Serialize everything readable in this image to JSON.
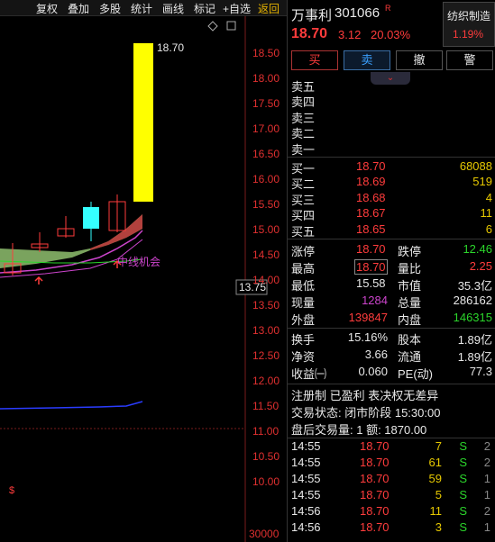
{
  "toolbar": {
    "items": [
      "复权",
      "叠加",
      "多股",
      "统计",
      "画线",
      "标记",
      "+自选",
      "返回"
    ]
  },
  "chart": {
    "y_ticks": [
      "18.50",
      "18.00",
      "17.50",
      "17.00",
      "16.50",
      "16.00",
      "15.50",
      "15.00",
      "14.50",
      "14.00",
      "13.50",
      "13.00",
      "12.50",
      "12.00",
      "11.50",
      "11.00",
      "10.50",
      "10.00"
    ],
    "current_price_tag": "13.75",
    "high_label": "18.70",
    "annotation": "中线机会",
    "s_marker": "$",
    "volume_tick": "30000",
    "colors": {
      "up": "#ff3c3c",
      "down": "#35ffff",
      "limit_bar": "#ffff00",
      "ma": "#cc44cc",
      "fill_green": "#8fbf6f"
    }
  },
  "stock": {
    "name": "万事利",
    "code": "301066",
    "badge": "R",
    "sector": "纺织制造",
    "sector_change": "1.19%",
    "price": "18.70",
    "change": "3.12",
    "change_pct": "20.03%"
  },
  "actions": {
    "buy": "买",
    "sell": "卖",
    "cancel": "撤",
    "alert": "警"
  },
  "sell_levels": [
    {
      "label": "卖五",
      "price": "",
      "vol": ""
    },
    {
      "label": "卖四",
      "price": "",
      "vol": ""
    },
    {
      "label": "卖三",
      "price": "",
      "vol": ""
    },
    {
      "label": "卖二",
      "price": "",
      "vol": ""
    },
    {
      "label": "卖一",
      "price": "",
      "vol": ""
    }
  ],
  "buy_levels": [
    {
      "label": "买一",
      "price": "18.70",
      "vol": "68088"
    },
    {
      "label": "买二",
      "price": "18.69",
      "vol": "519"
    },
    {
      "label": "买三",
      "price": "18.68",
      "vol": "4"
    },
    {
      "label": "买四",
      "price": "18.67",
      "vol": "11"
    },
    {
      "label": "买五",
      "price": "18.65",
      "vol": "6"
    }
  ],
  "stats1": [
    {
      "l": "涨停",
      "v": "18.70",
      "r": "跌停",
      "rv": "12.46"
    },
    {
      "l": "最高",
      "v": "18.70",
      "r": "量比",
      "rv": "2.25"
    },
    {
      "l": "最低",
      "v": "15.58",
      "r": "市值",
      "rv": "35.3亿"
    },
    {
      "l": "现量",
      "v": "1284",
      "r": "总量",
      "rv": "286162"
    },
    {
      "l": "外盘",
      "v": "139847",
      "r": "内盘",
      "rv": "146315"
    }
  ],
  "stats2": [
    {
      "l": "换手",
      "v": "15.16%",
      "r": "股本",
      "rv": "1.89亿"
    },
    {
      "l": "净资",
      "v": "3.66",
      "r": "流通",
      "rv": "1.89亿"
    },
    {
      "l": "收益㈠",
      "v": "0.060",
      "r": "PE(动)",
      "rv": "77.3"
    }
  ],
  "info": {
    "tags": "注册制 已盈利 表决权无差异",
    "status": "交易状态: 闭市阶段 15:30:00",
    "after_hours": "盘后交易量: 1  额: 1870.00"
  },
  "ticks": [
    {
      "t": "14:55",
      "p": "18.70",
      "v": "7",
      "s": "S",
      "n": "2"
    },
    {
      "t": "14:55",
      "p": "18.70",
      "v": "61",
      "s": "S",
      "n": "2"
    },
    {
      "t": "14:55",
      "p": "18.70",
      "v": "59",
      "s": "S",
      "n": "1"
    },
    {
      "t": "14:55",
      "p": "18.70",
      "v": "5",
      "s": "S",
      "n": "1"
    },
    {
      "t": "14:56",
      "p": "18.70",
      "v": "11",
      "s": "S",
      "n": "2"
    },
    {
      "t": "14:56",
      "p": "18.70",
      "v": "3",
      "s": "S",
      "n": "1"
    }
  ]
}
